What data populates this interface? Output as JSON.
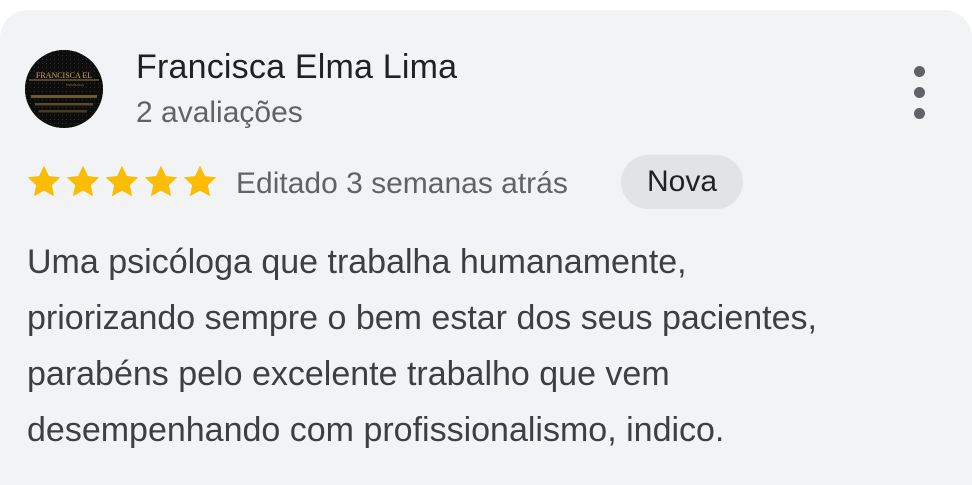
{
  "review": {
    "author_name": "Francisca Elma Lima",
    "author_reviews": "2 avaliações",
    "avatar_logo_text": "FRANCISCA EL",
    "rating": 5,
    "rating_max": 5,
    "star_color": "#fbbc04",
    "time_label": "Editado 3 semanas atrás",
    "badge_label": "Nova",
    "text": "Uma psicóloga que trabalha humanamente,\npriorizando sempre o bem estar dos seus pacientes,\nparabéns pelo excelente trabalho que vem\ndesempenhando com profissionalismo, indico.",
    "menu_icon": "more-vert-icon"
  }
}
